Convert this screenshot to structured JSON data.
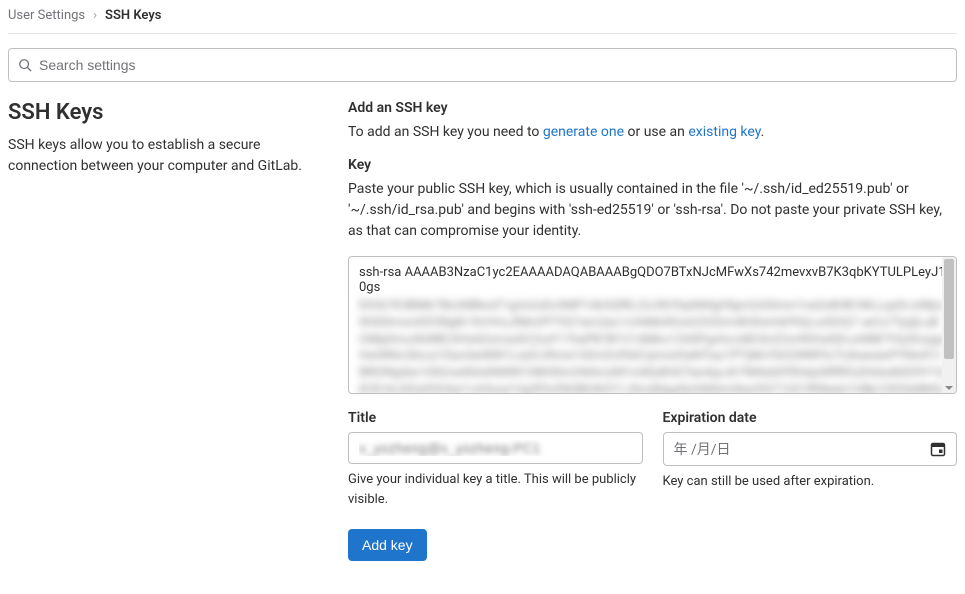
{
  "breadcrumb": {
    "parent": "User Settings",
    "current": "SSH Keys"
  },
  "search": {
    "placeholder": "Search settings"
  },
  "sidebar": {
    "title": "SSH Keys",
    "description": "SSH keys allow you to establish a secure connection between your computer and GitLab."
  },
  "form": {
    "add_heading": "Add an SSH key",
    "add_help_prefix": "To add an SSH key you need to ",
    "generate_link": "generate one",
    "add_help_mid": " or use an ",
    "existing_link": "existing key",
    "add_help_suffix": ".",
    "key_label": "Key",
    "key_help": "Paste your public SSH key, which is usually contained in the file '~/.ssh/id_ed25519.pub' or '~/.ssh/id_rsa.pub' and begins with 'ssh-ed25519' or 'ssh-rsa'. Do not paste your private SSH key, as that can compromise your identity.",
    "key_value_visible": "ssh-rsa AAAAB3NzaC1yc2EAAAADAQABAAABgQDO7BTxNJcMFwXs742mevxvB7K3qbKYTULPLeyJ10gs",
    "title_label": "Title",
    "title_value": "x_yozheng@x_yozheng-PC1",
    "title_hint": "Give your individual key a title. This will be publicly visible.",
    "expiration_label": "Expiration date",
    "expiration_placeholder": "年 /月/日",
    "expiration_hint": "Key can still be used after expiration.",
    "submit_label": "Add key"
  }
}
